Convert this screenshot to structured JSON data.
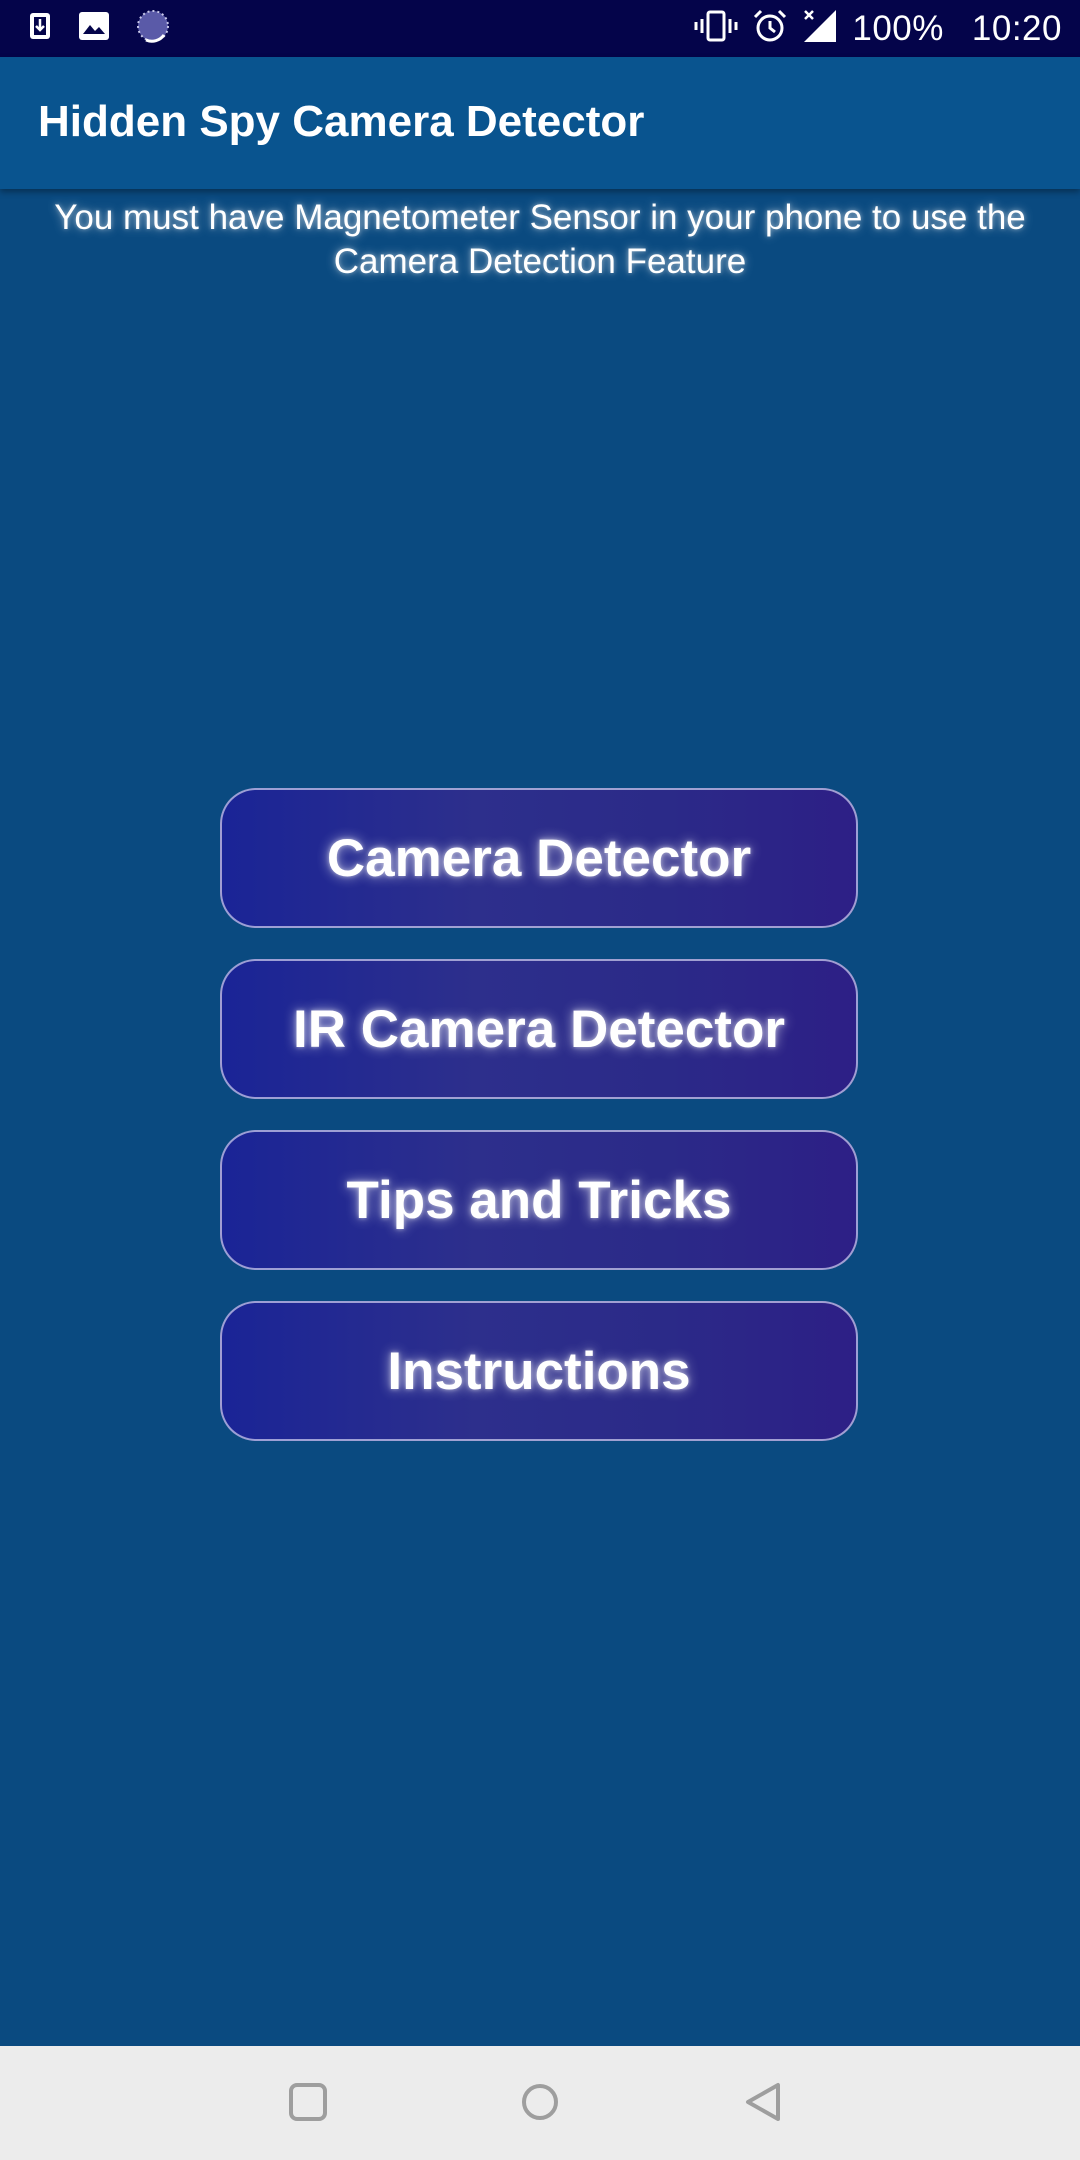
{
  "status_bar": {
    "left_icons": [
      "download-notification-icon",
      "image-notification-icon",
      "loading-circle-icon"
    ],
    "right_icons": [
      "vibrate-icon",
      "alarm-icon",
      "no-signal-icon"
    ],
    "battery": "100%",
    "time": "10:20"
  },
  "app_bar": {
    "title": "Hidden Spy Camera Detector"
  },
  "notice": {
    "line1": "You must have Magnetometer Sensor in your phone to use the",
    "line2": "Camera Detection Feature"
  },
  "menu": {
    "buttons": [
      {
        "label": "Camera Detector"
      },
      {
        "label": "IR Camera Detector"
      },
      {
        "label": "Tips and Tricks"
      },
      {
        "label": "Instructions"
      }
    ]
  },
  "nav_bar": {
    "buttons": [
      "recents-icon",
      "home-icon",
      "back-icon"
    ]
  },
  "colors": {
    "status_bar": "#04044a",
    "app_bar": "#09548f",
    "background": "#0a4a80",
    "button": "#2a2a8c",
    "nav_bar": "#ececec"
  }
}
